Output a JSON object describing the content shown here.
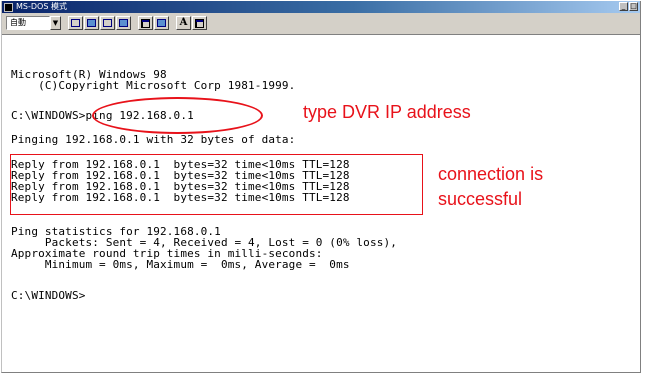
{
  "window": {
    "title": "MS-DOS 模式",
    "titlebar_gradient": [
      "#0a246a",
      "#a6caf0"
    ],
    "controls": [
      "minimize",
      "maximize"
    ]
  },
  "toolbar": {
    "font_select_value": "自動",
    "buttons": [
      {
        "icon": "mark-icon"
      },
      {
        "icon": "copy-icon"
      },
      {
        "icon": "paste-icon"
      },
      {
        "icon": "fullscreen-icon"
      },
      {
        "icon": "properties-icon"
      },
      {
        "icon": "background-icon"
      },
      {
        "label": "A",
        "icon": "font-icon"
      },
      {
        "icon": "edit-icon"
      }
    ]
  },
  "console": {
    "lines": [
      "Microsoft(R) Windows 98",
      "    (C)Copyright Microsoft Corp 1981-1999.",
      "C:\\WINDOWS>ping 192.168.0.1",
      "Pinging 192.168.0.1 with 32 bytes of data:",
      "Reply from 192.168.0.1  bytes=32 time<10ms TTL=128",
      "Reply from 192.168.0.1  bytes=32 time<10ms TTL=128",
      "Reply from 192.168.0.1  bytes=32 time<10ms TTL=128",
      "Reply from 192.168.0.1  bytes=32 time<10ms TTL=128",
      "Ping statistics for 192.168.0.1",
      "     Packets: Sent = 4, Received = 4, Lost = 0 (0% loss),",
      "Approximate round trip times in milli-seconds:",
      "     Minimum = 0ms, Maximum =  0ms, Average =  0ms",
      "C:\\WINDOWS>"
    ]
  },
  "annotations": {
    "ip_hint": "type DVR IP address",
    "success_line1": "connection is",
    "success_line2": "successful",
    "color": "#e8121a"
  }
}
